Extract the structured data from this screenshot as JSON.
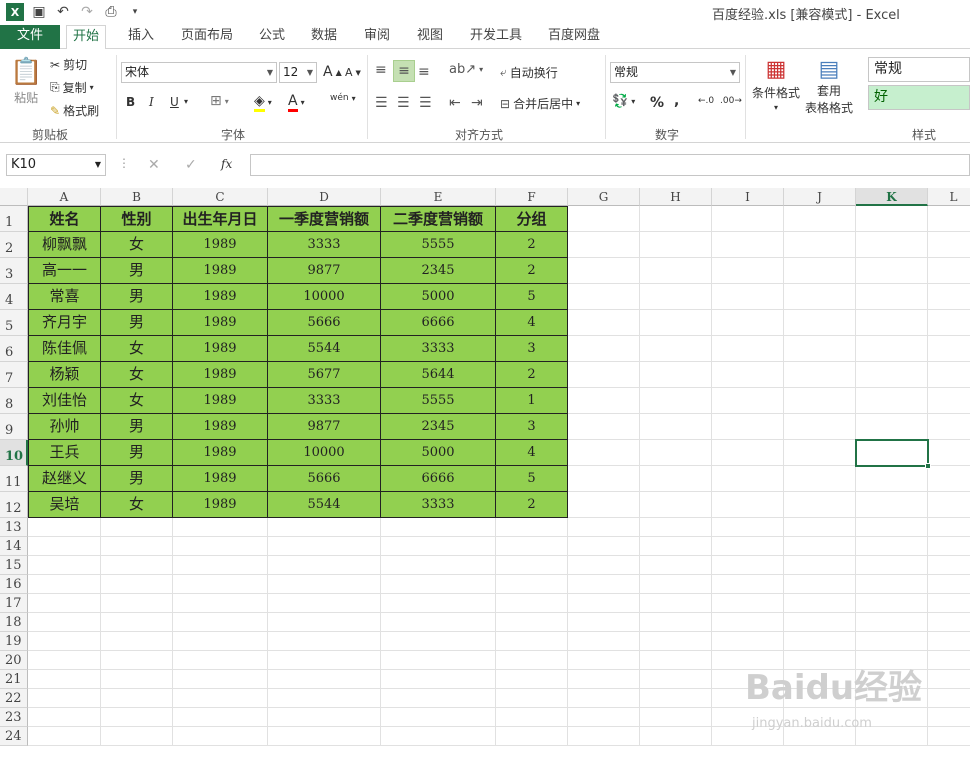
{
  "title": "百度经验.xls  [兼容模式] - Excel",
  "tabs": [
    "文件",
    "开始",
    "插入",
    "页面布局",
    "公式",
    "数据",
    "审阅",
    "视图",
    "开发工具",
    "百度网盘"
  ],
  "clipboard": {
    "paste": "粘贴",
    "cut": "剪切",
    "copy": "复制",
    "format_painter": "格式刷",
    "label": "剪贴板"
  },
  "font": {
    "name": "宋体",
    "size": "12",
    "label": "字体",
    "bold": "B",
    "italic": "I",
    "underline": "U",
    "wen": "wén"
  },
  "alignment": {
    "wrap": "自动换行",
    "merge": "合并后居中",
    "label": "对齐方式"
  },
  "number": {
    "format": "常规",
    "label": "数字",
    "percent": "%",
    "comma": ","
  },
  "styles": {
    "conditional": "条件格式",
    "table_format_1": "套用",
    "table_format_2": "表格格式",
    "normal": "常规",
    "good": "好",
    "label": "样式"
  },
  "name_box": "K10",
  "fx": "fx",
  "columns": [
    "A",
    "B",
    "C",
    "D",
    "E",
    "F",
    "G",
    "H",
    "I",
    "J",
    "K",
    "L"
  ],
  "rows": [
    "1",
    "2",
    "3",
    "4",
    "5",
    "6",
    "7",
    "8",
    "9",
    "10",
    "11",
    "12",
    "13",
    "14",
    "15",
    "16",
    "17",
    "18",
    "19",
    "20",
    "21",
    "22",
    "23",
    "24"
  ],
  "table": {
    "headers": [
      "姓名",
      "性别",
      "出生年月日",
      "一季度营销额",
      "二季度营销额",
      "分组"
    ],
    "rows": [
      [
        "柳飘飘",
        "女",
        "1989",
        "3333",
        "5555",
        "2"
      ],
      [
        "高一一",
        "男",
        "1989",
        "9877",
        "2345",
        "2"
      ],
      [
        "常喜",
        "男",
        "1989",
        "10000",
        "5000",
        "5"
      ],
      [
        "齐月宇",
        "男",
        "1989",
        "5666",
        "6666",
        "4"
      ],
      [
        "陈佳佩",
        "女",
        "1989",
        "5544",
        "3333",
        "3"
      ],
      [
        "杨颖",
        "女",
        "1989",
        "5677",
        "5644",
        "2"
      ],
      [
        "刘佳怡",
        "女",
        "1989",
        "3333",
        "5555",
        "1"
      ],
      [
        "孙帅",
        "男",
        "1989",
        "9877",
        "2345",
        "3"
      ],
      [
        "王兵",
        "男",
        "1989",
        "10000",
        "5000",
        "4"
      ],
      [
        "赵继义",
        "男",
        "1989",
        "5666",
        "6666",
        "5"
      ],
      [
        "吴培",
        "女",
        "1989",
        "5544",
        "3333",
        "2"
      ]
    ]
  },
  "watermark": "Baidu经验",
  "watermark_url": "jingyan.baidu.com",
  "colors": {
    "accent": "#217346",
    "fill": "#92d050"
  }
}
